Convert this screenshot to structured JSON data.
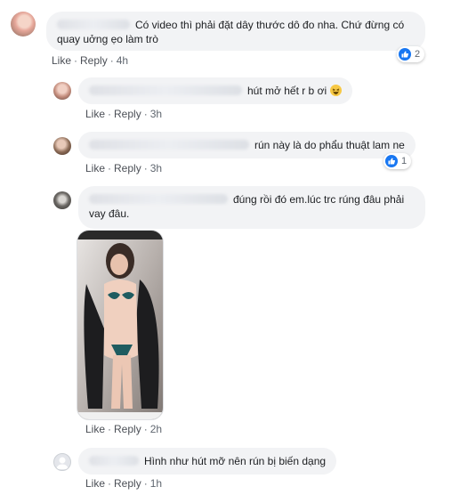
{
  "comments": [
    {
      "text": "Có video thì phải đặt dây thước dô đo nha. Chứ đừng có quay uởng ẹo làm trò",
      "like_label": "Like",
      "reply_label": "Reply",
      "time": "4h",
      "reaction_count": "2",
      "avatar_icon": "avatar-photo"
    },
    {
      "text": "hút mở hết r b ơi",
      "emoji": "laughing-emoji",
      "like_label": "Like",
      "reply_label": "Reply",
      "time": "3h",
      "avatar_icon": "avatar-photo"
    },
    {
      "text": "rún này là do phẩu thuật lam ne",
      "like_label": "Like",
      "reply_label": "Reply",
      "time": "3h",
      "reaction_count": "1",
      "avatar_icon": "avatar-photo"
    },
    {
      "text": "đúng rồi đó em.lúc trc rúng đâu phải vay đâu.",
      "like_label": "Like",
      "reply_label": "Reply",
      "time": "2h",
      "avatar_icon": "avatar-photo",
      "attachment": "photo-attachment"
    },
    {
      "text": "Hình như hút mỡ nên rún bị biến dạng",
      "like_label": "Like",
      "reply_label": "Reply",
      "time": "1h",
      "avatar_icon": "default-avatar-icon"
    }
  ],
  "colors": {
    "link_blue": "#1877f2",
    "bubble_bg": "#f2f3f5",
    "meta_gray": "#606770"
  },
  "separator": "·"
}
